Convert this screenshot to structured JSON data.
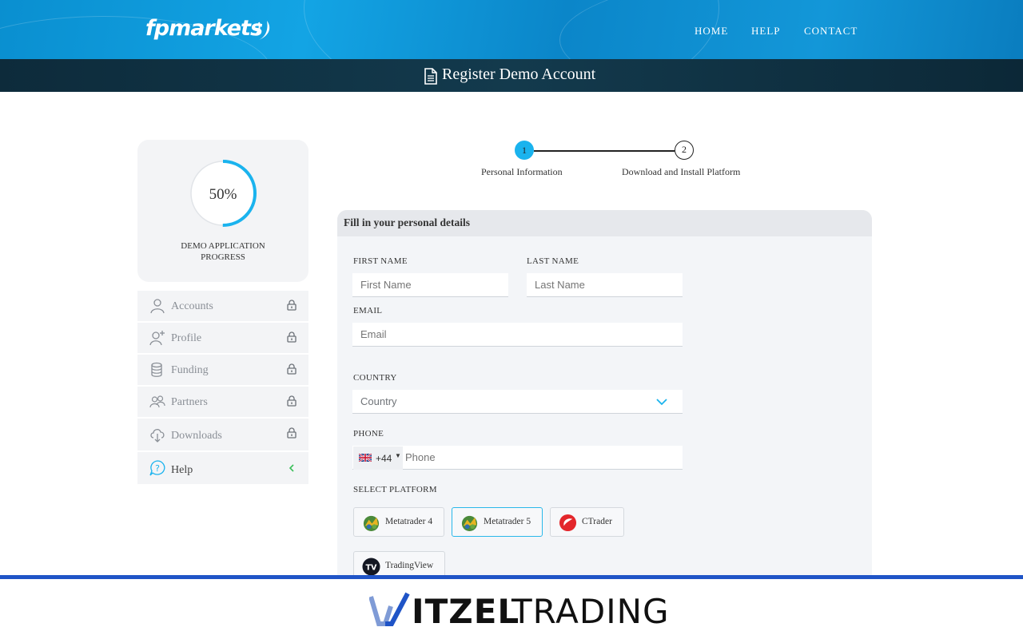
{
  "header": {
    "logo_text": "fpmarkets",
    "nav": [
      "HOME",
      "HELP",
      "CONTACT"
    ],
    "page_title": "Register Demo Account"
  },
  "sidebar": {
    "progress_value": "50%",
    "progress_fraction": 0.5,
    "progress_label_line1": "DEMO APPLICATION",
    "progress_label_line2": "PROGRESS",
    "items": [
      {
        "label": "Accounts",
        "icon": "user-icon",
        "locked": true
      },
      {
        "label": "Profile",
        "icon": "user-add-icon",
        "locked": true
      },
      {
        "label": "Funding",
        "icon": "coins-icon",
        "locked": true
      },
      {
        "label": "Partners",
        "icon": "users-icon",
        "locked": true
      },
      {
        "label": "Downloads",
        "icon": "cloud-download-icon",
        "locked": true
      },
      {
        "label": "Help",
        "icon": "help-icon",
        "locked": false
      }
    ]
  },
  "stepper": {
    "steps": [
      {
        "number": "1",
        "label": "Personal Information",
        "active": true
      },
      {
        "number": "2",
        "label": "Download and Install Platform",
        "active": false
      }
    ]
  },
  "form": {
    "heading": "Fill in your personal details",
    "first_name": {
      "label": "FIRST NAME",
      "placeholder": "First Name"
    },
    "last_name": {
      "label": "LAST NAME",
      "placeholder": "Last Name"
    },
    "email": {
      "label": "EMAIL",
      "placeholder": "Email"
    },
    "country": {
      "label": "COUNTRY",
      "value": "Country"
    },
    "phone": {
      "label": "PHONE",
      "dial_code": "+44",
      "placeholder": "Phone"
    },
    "platform": {
      "label": "SELECT PLATFORM",
      "options": [
        "Metatrader 4",
        "Metatrader 5",
        "CTrader",
        "TradingView"
      ],
      "selected": "Metatrader 5"
    }
  },
  "banner": {
    "word1": "WITZEL",
    "word2": "TRADING"
  },
  "colors": {
    "accent": "#1ab3ee",
    "header_blue": "#0f96d6",
    "titlebar": "#10303f",
    "banner_blue": "#1f54c7",
    "help_green": "#3bbf5a"
  }
}
